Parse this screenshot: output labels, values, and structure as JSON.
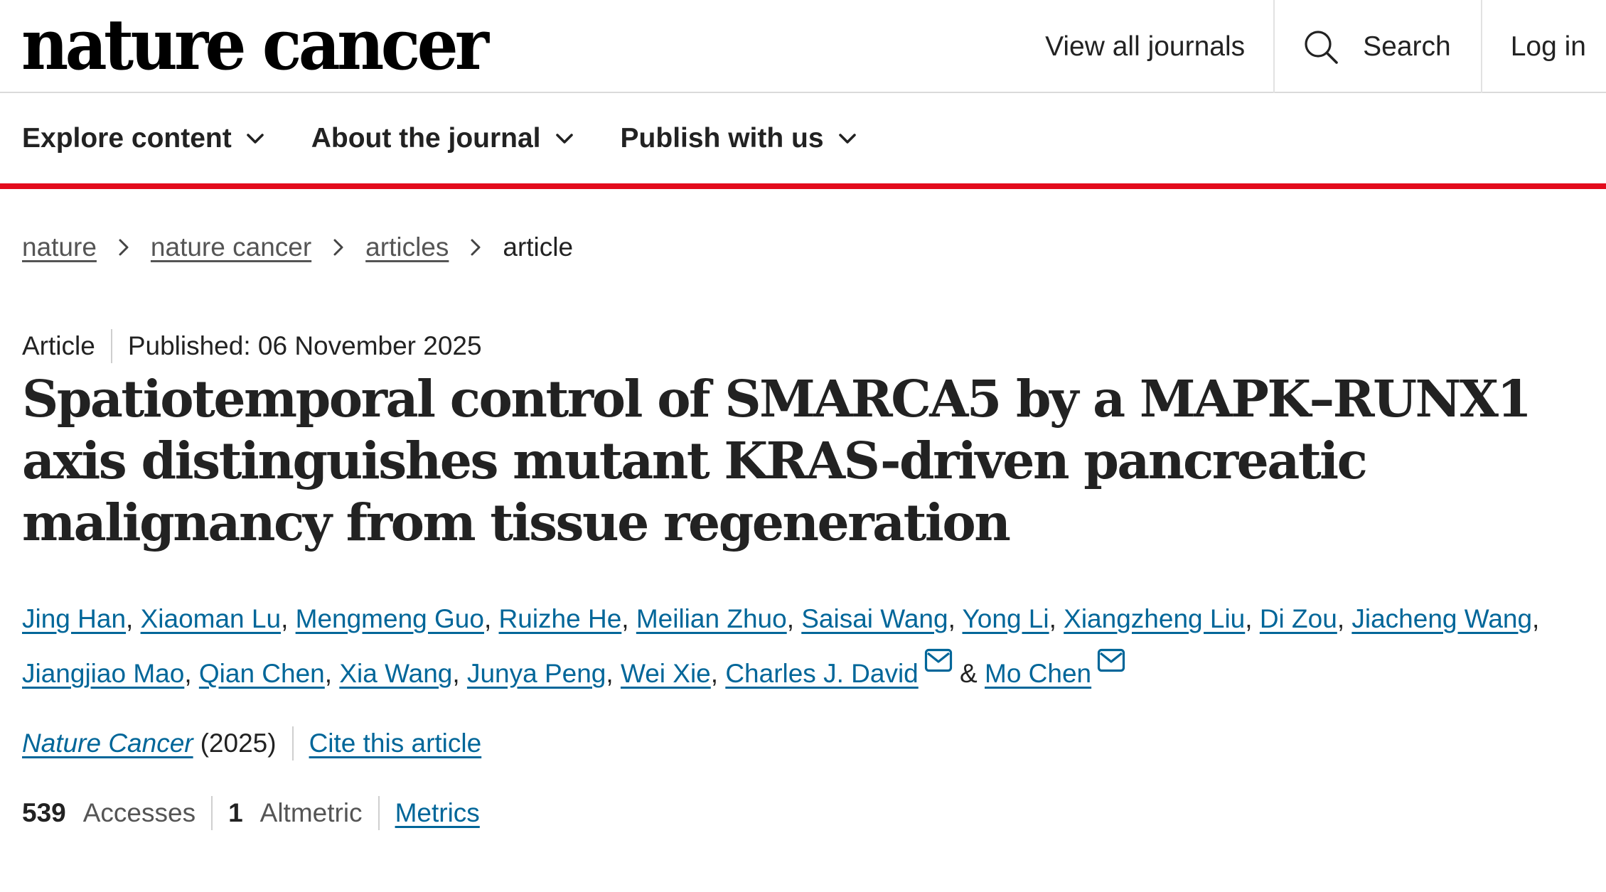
{
  "header": {
    "logo": "nature cancer",
    "view_all_journals": "View all journals",
    "search_label": "Search",
    "login_label": "Log in"
  },
  "nav": {
    "items": [
      {
        "label": "Explore content"
      },
      {
        "label": "About the journal"
      },
      {
        "label": "Publish with us"
      }
    ]
  },
  "breadcrumb": {
    "items": [
      {
        "label": "nature"
      },
      {
        "label": "nature cancer"
      },
      {
        "label": "articles"
      }
    ],
    "current": "article"
  },
  "article": {
    "type": "Article",
    "published": "Published: 06 November 2025",
    "title": "Spatiotemporal control of SMARCA5 by a MAPK–RUNX1 axis distinguishes mutant KRAS-driven pancreatic malignancy from tissue regeneration",
    "authors": [
      "Jing Han",
      "Xiaoman Lu",
      "Mengmeng Guo",
      "Ruizhe He",
      "Meilian Zhuo",
      "Saisai Wang",
      "Yong Li",
      "Xiangzheng Liu",
      "Di Zou",
      "Jiacheng Wang",
      "Jiangjiao Mao",
      "Qian Chen",
      "Xia Wang",
      "Junya Peng",
      "Wei Xie",
      "Charles J. David",
      "Mo Chen"
    ],
    "separator": ",",
    "ampersand": "&",
    "journal": "Nature Cancer",
    "year": "(2025)",
    "cite_label": "Cite this article"
  },
  "metrics": {
    "accesses_count": "539",
    "accesses_label": "Accesses",
    "altmetric_count": "1",
    "altmetric_label": "Altmetric",
    "metrics_link": "Metrics"
  },
  "colors": {
    "link": "#006699",
    "accent_bar": "#e30b1c",
    "text": "#222222"
  }
}
